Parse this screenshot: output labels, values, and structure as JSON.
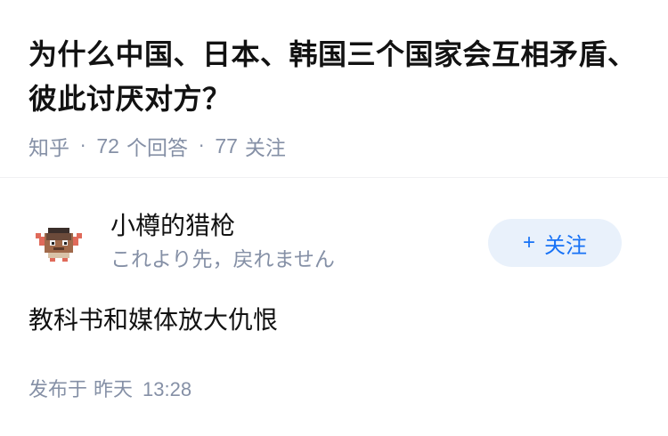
{
  "question": {
    "title": "为什么中国、日本、韩国三个国家会互相矛盾、彼此讨厌对方？",
    "source": "知乎",
    "answers_count": "72",
    "answers_label": "个回答",
    "followers_count": "77",
    "followers_label": "关注"
  },
  "answer": {
    "author_name": "小樽的猎枪",
    "author_bio": "これより先，戻れません",
    "follow_label": "关注",
    "follow_icon": "plus-icon",
    "content": "教科书和媒体放大仇恨",
    "published_label": "发布于",
    "published_day": "昨天",
    "published_time": "13:28"
  },
  "colors": {
    "meta_gray": "#8590a6",
    "brand_blue": "#1772f6",
    "follow_bg": "#e9f1fb",
    "text": "#121212"
  }
}
